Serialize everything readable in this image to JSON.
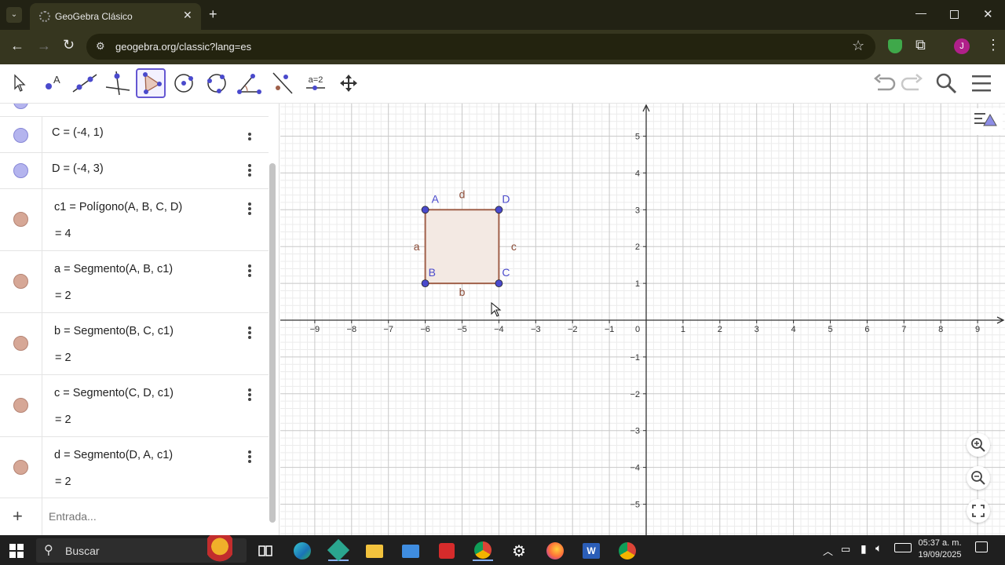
{
  "browser": {
    "tab_title": "GeoGebra Clásico",
    "url": "geogebra.org/classic?lang=es",
    "profile_initial": "J"
  },
  "toolbar": {
    "tools": [
      "move-tool",
      "point-tool",
      "line-tool",
      "perpendicular-tool",
      "polygon-tool",
      "circle-center-tool",
      "circle-three-points-tool",
      "angle-tool",
      "reflect-tool",
      "slider-tool",
      "move-graphics-tool"
    ],
    "slider_label": "a=2",
    "selected_tool": "polygon-tool"
  },
  "algebra": {
    "rows": [
      {
        "name": "C",
        "def": "C = (-4, 1)",
        "value": "",
        "color": "blue"
      },
      {
        "name": "D",
        "def": "D = (-4, 3)",
        "value": "",
        "color": "blue"
      },
      {
        "name": "c1",
        "def": "c1 = Polígono(A, B, C, D)",
        "value": "= 4",
        "color": "brown"
      },
      {
        "name": "a",
        "def": "a = Segmento(A, B, c1)",
        "value": "= 2",
        "color": "brown"
      },
      {
        "name": "b",
        "def": "b = Segmento(B, C, c1)",
        "value": "= 2",
        "color": "brown"
      },
      {
        "name": "c",
        "def": "c = Segmento(C, D, c1)",
        "value": "= 2",
        "color": "brown"
      },
      {
        "name": "d",
        "def": "d = Segmento(D, A, c1)",
        "value": "= 2",
        "color": "brown"
      }
    ],
    "input_placeholder": "Entrada...",
    "add_symbol": "+"
  },
  "graphics": {
    "x_ticks": [
      "−9",
      "−8",
      "−7",
      "−6",
      "−5",
      "−4",
      "−3",
      "−2",
      "−1",
      "0",
      "1",
      "2",
      "3",
      "4",
      "5",
      "6",
      "7",
      "8",
      "9"
    ],
    "y_ticks_pos": [
      "5",
      "4",
      "3",
      "2",
      "1"
    ],
    "y_ticks_neg": [
      "−1",
      "−2",
      "−3",
      "−4",
      "−5"
    ],
    "point_labels": {
      "A": "A",
      "B": "B",
      "C": "C",
      "D": "D"
    },
    "segment_labels": {
      "a": "a",
      "b": "b",
      "c": "c",
      "d": "d"
    },
    "points": {
      "A": [
        -6,
        3
      ],
      "B": [
        -6,
        1
      ],
      "C": [
        -4,
        1
      ],
      "D": [
        -4,
        3
      ]
    },
    "colors": {
      "point": "#4a4acc",
      "polygon_edge": "#a0604a",
      "polygon_fill": "#f3e9e3",
      "grid_major": "#c8c8c8",
      "grid_minor": "#ececec"
    }
  },
  "taskbar": {
    "search_label": "Buscar",
    "time": "05:37 a. m.",
    "date": "19/09/2025"
  }
}
